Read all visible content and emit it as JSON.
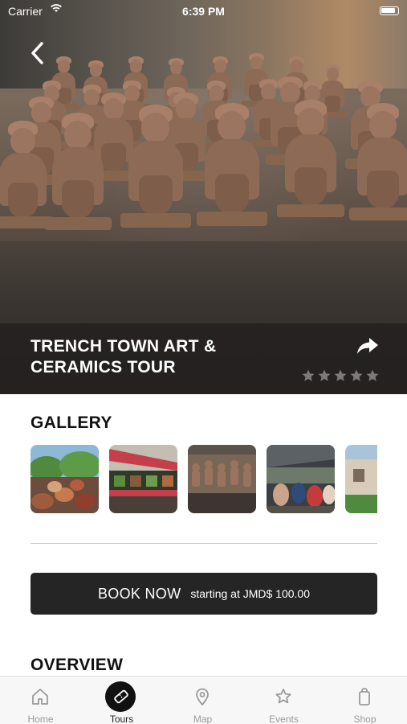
{
  "status_bar": {
    "carrier": "Carrier",
    "time": "6:39 PM",
    "wifi_icon": "wifi-icon",
    "battery_icon": "battery-icon"
  },
  "hero": {
    "title": "TRENCH TOWN ART &\nCERAMICS TOUR",
    "back_icon": "chevron-left-icon",
    "share_icon": "share-arrow-icon",
    "rating": {
      "value": 0,
      "max": 5
    }
  },
  "gallery": {
    "title": "GALLERY",
    "images": [
      {
        "name": "gallery-image-1"
      },
      {
        "name": "gallery-image-2"
      },
      {
        "name": "gallery-image-3"
      },
      {
        "name": "gallery-image-4"
      },
      {
        "name": "gallery-image-5"
      }
    ]
  },
  "book": {
    "label": "BOOK NOW",
    "price": "starting at JMD$ 100.00"
  },
  "overview": {
    "title": "OVERVIEW"
  },
  "tabbar": {
    "active": "Tours",
    "items": [
      {
        "label": "Home",
        "icon": "home-icon"
      },
      {
        "label": "Tours",
        "icon": "ticket-icon"
      },
      {
        "label": "Map",
        "icon": "map-pin-icon"
      },
      {
        "label": "Events",
        "icon": "star-icon"
      },
      {
        "label": "Shop",
        "icon": "shopping-bag-icon"
      }
    ]
  },
  "colors": {
    "dark": "#252525",
    "star_empty": "#7a7a7a",
    "tab_inactive": "#9a9a9a"
  }
}
